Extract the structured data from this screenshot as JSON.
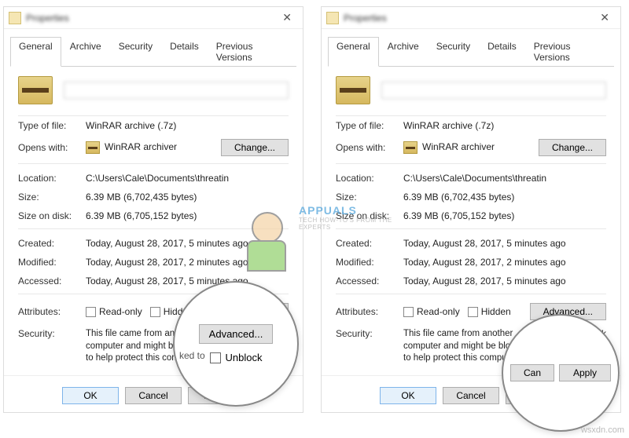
{
  "window": {
    "title": "Properties",
    "close_glyph": "✕"
  },
  "tabs": [
    "General",
    "Archive",
    "Security",
    "Details",
    "Previous Versions"
  ],
  "fields": {
    "type_label": "Type of file:",
    "type_value": "WinRAR archive (.7z)",
    "opens_label": "Opens with:",
    "opens_value": "WinRAR archiver",
    "change_btn": "Change...",
    "location_label": "Location:",
    "location_value": "C:\\Users\\Cale\\Documents\\threatin",
    "size_label": "Size:",
    "size_value": "6.39 MB (6,702,435 bytes)",
    "disk_label": "Size on disk:",
    "disk_value": "6.39 MB (6,705,152 bytes)",
    "created_label": "Created:",
    "created_value": "Today, August 28, 2017, 5 minutes ago",
    "modified_label": "Modified:",
    "modified_value": "Today, August 28, 2017, 2 minutes ago",
    "accessed_label": "Accessed:",
    "accessed_value": "Today, August 28, 2017, 5 minutes ago",
    "attr_label": "Attributes:",
    "readonly_label": "Read-only",
    "hidden_label": "Hidden",
    "advanced_btn": "Advanced...",
    "security_label": "Security:",
    "security_text_partial": "This file came from another computer and might be blocked to help protect this computer.",
    "security_text_full": "This file came from another computer and might be blocked to help protect this computer.",
    "unblock_label": "Unblock",
    "ok": "OK",
    "cancel": "Cancel",
    "apply": "Apply"
  },
  "magnifier1": {
    "advanced": "Advanced...",
    "sidetext": "ked to",
    "unblock": "Unblock"
  },
  "magnifier2": {
    "cancel": "Can",
    "apply": "Apply"
  },
  "mascot": {
    "brand": "APPUALS",
    "tag": "TECH HOW-TO'S FROM THE EXPERTS"
  },
  "watermark": "wsxdn.com"
}
